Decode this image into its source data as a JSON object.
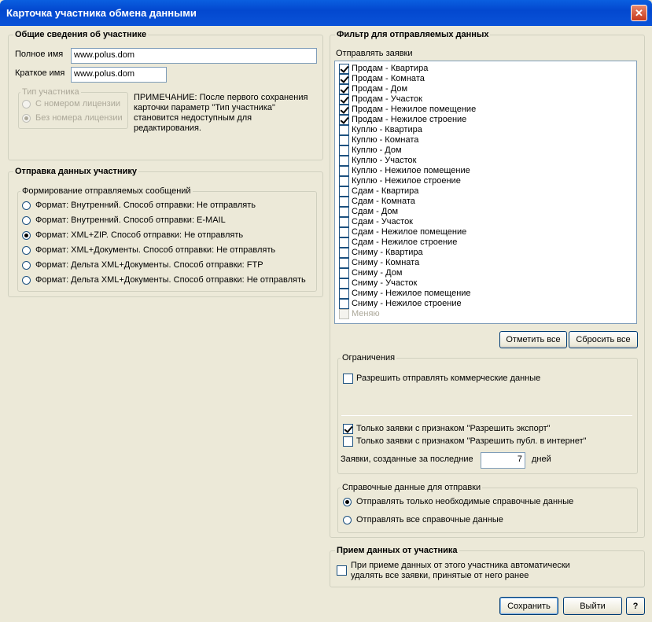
{
  "window": {
    "title": "Карточка участника обмена данными",
    "close_glyph": "✕"
  },
  "general": {
    "title": "Общие сведения об участнике",
    "full_name_label": "Полное имя",
    "full_name_value": "www.polus.dom",
    "short_name_label": "Краткое имя",
    "short_name_value": "www.polus.dom",
    "participant_type": {
      "title": "Тип участника",
      "options": [
        "С номером лицензии",
        "Без номера лицензии"
      ],
      "selected": 1
    },
    "note": [
      "ПРИМЕЧАНИЕ: После первого сохранения",
      "карточки параметр \"Тип участника\"",
      "становится недоступным для",
      "редактирования."
    ]
  },
  "send": {
    "title": "Отправка данных участнику",
    "group_title": "Формирование отправляемых сообщений",
    "options": [
      "Формат: Внутренний. Способ отправки: Не отправлять",
      "Формат: Внутренний. Способ отправки: E-MAIL",
      "Формат: XML+ZIP. Способ отправки: Не отправлять",
      "Формат: XML+Документы. Способ отправки: Не отправлять",
      "Формат: Дельта XML+Документы. Способ отправки: FTP",
      "Формат: Дельта XML+Документы. Способ отправки: Не отправлять"
    ],
    "selected": 2
  },
  "filter": {
    "title": "Фильтр для отправляемых данных",
    "list_label": "Отправлять заявки",
    "items": [
      {
        "label": "Продам - Квартира",
        "checked": true
      },
      {
        "label": "Продам - Комната",
        "checked": true
      },
      {
        "label": "Продам - Дом",
        "checked": true
      },
      {
        "label": "Продам - Участок",
        "checked": true
      },
      {
        "label": "Продам - Нежилое помещение",
        "checked": true
      },
      {
        "label": "Продам - Нежилое строение",
        "checked": true
      },
      {
        "label": "Куплю - Квартира",
        "checked": false
      },
      {
        "label": "Куплю - Комната",
        "checked": false
      },
      {
        "label": "Куплю - Дом",
        "checked": false
      },
      {
        "label": "Куплю - Участок",
        "checked": false
      },
      {
        "label": "Куплю - Нежилое помещение",
        "checked": false
      },
      {
        "label": "Куплю - Нежилое строение",
        "checked": false
      },
      {
        "label": "Сдам - Квартира",
        "checked": false
      },
      {
        "label": "Сдам - Комната",
        "checked": false
      },
      {
        "label": "Сдам - Дом",
        "checked": false
      },
      {
        "label": "Сдам - Участок",
        "checked": false
      },
      {
        "label": "Сдам - Нежилое помещение",
        "checked": false
      },
      {
        "label": "Сдам - Нежилое строение",
        "checked": false
      },
      {
        "label": "Сниму - Квартира",
        "checked": false
      },
      {
        "label": "Сниму - Комната",
        "checked": false
      },
      {
        "label": "Сниму - Дом",
        "checked": false
      },
      {
        "label": "Сниму - Участок",
        "checked": false
      },
      {
        "label": "Сниму - Нежилое помещение",
        "checked": false
      },
      {
        "label": "Сниму - Нежилое строение",
        "checked": false
      },
      {
        "label": "Меняю",
        "checked": false,
        "disabled": true
      }
    ],
    "select_all_label": "Отметить все",
    "reset_all_label": "Сбросить все",
    "limits": {
      "title": "Ограничения",
      "allow_commercial": {
        "label": "Разрешить отправлять коммерческие данные",
        "checked": false
      },
      "only_export": {
        "label": "Только заявки с признаком \"Разрешить экспорт\"",
        "checked": true
      },
      "only_public": {
        "label": "Только заявки с признаком \"Разрешить публ. в интернет\"",
        "checked": false
      },
      "days_label": "Заявки, созданные за последние",
      "days_value": "7",
      "days_unit": "дней"
    },
    "reference": {
      "title": "Справочные данные для отправки",
      "options": [
        "Отправлять только необходимые справочные данные",
        "Отправлять все справочные данные"
      ],
      "selected": 0
    }
  },
  "receive": {
    "title": "Прием данных от участника",
    "auto_delete": {
      "label_line1": "При приеме данных от этого участника автоматически",
      "label_line2": "удалять все заявки, принятые от него ранее",
      "checked": false
    }
  },
  "footer": {
    "save_label": "Сохранить",
    "exit_label": "Выйти",
    "help_label": "?"
  }
}
